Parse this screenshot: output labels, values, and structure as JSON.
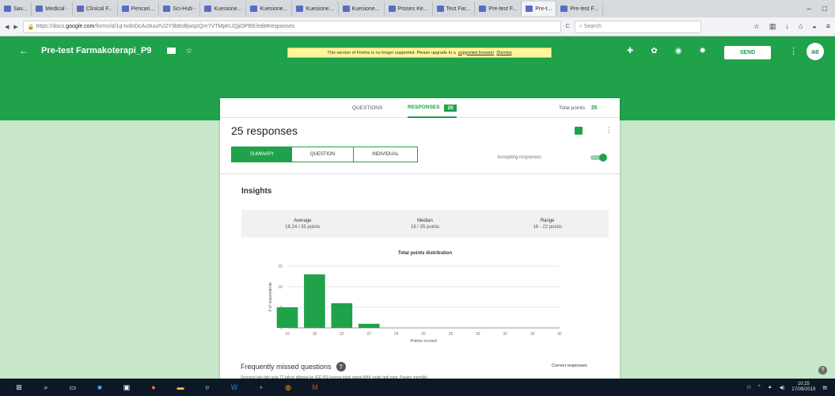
{
  "browser": {
    "tabs": [
      "Sav...",
      "Medical -",
      "Clinical F...",
      "Pencari...",
      "Sci-Hub -",
      "Kuesione...",
      "Kuesione...",
      "Kuesione...",
      "Kuesione...",
      "Proses Ke...",
      "Test Far...",
      "Pre-test F...",
      "Pre-t...",
      "Pre-test F..."
    ],
    "url_prefix": "https://docs.",
    "url_domain": "google.com",
    "url_path": "/forms/d/1q-tvdoDcAo9uurhJ2Y9b8sBjwqzQrn7VTMpKUQjiOPBE/edit#responses",
    "search_placeholder": "Search"
  },
  "form": {
    "title": "Pre-test Farmakoterapi_P9",
    "notice_text": "This version of Firefox is no longer supported. Please upgrade to a",
    "notice_link": "supported browser",
    "notice_dismiss": "Dismiss",
    "send_label": "SEND",
    "avatar_text": "ae"
  },
  "tabs": {
    "questions": "QUESTIONS",
    "responses": "RESPONSES",
    "responses_count": "25",
    "total_points_label": "Total points:",
    "total_points_value": "35"
  },
  "summary": {
    "count_text": "25 responses",
    "seg_summary": "SUMMARY",
    "seg_question": "QUESTION",
    "seg_individual": "INDIVIDUAL",
    "accepting_label": "Accepting responses",
    "accepting_on": true,
    "insights_title": "Insights",
    "stats": [
      {
        "label": "Average",
        "value": "18.24 / 35 points"
      },
      {
        "label": "Median",
        "value": "18 / 35 points"
      },
      {
        "label": "Range",
        "value": "16 - 22 points"
      }
    ],
    "freq_title": "Frequently missed questions",
    "correct_label": "Correct responses",
    "question_text": "Seorang laki-laki usia 72 tahun dibawa ke IGD RS karena tidak dapat BAK sejak tadi pagi. Pasien memiliki"
  },
  "chart_data": {
    "type": "bar",
    "title": "Total points distribution",
    "xlabel": "Points scored",
    "ylabel": "# of respondents",
    "x_ticks": [
      "16",
      "18",
      "20",
      "22",
      "24",
      "26",
      "28",
      "30",
      "32",
      "34",
      "36"
    ],
    "categories": [
      "16",
      "18",
      "20",
      "22"
    ],
    "values": [
      5,
      13,
      6,
      1
    ],
    "y_ticks": [
      0,
      5,
      10,
      15
    ],
    "ylim": [
      0,
      15
    ],
    "color": "#1fa24a",
    "grid": true
  },
  "taskbar": {
    "time": "10:25",
    "date": "17/09/2019"
  },
  "colors": {
    "accent": "#1fa24a",
    "background": "#c8e6c9"
  }
}
